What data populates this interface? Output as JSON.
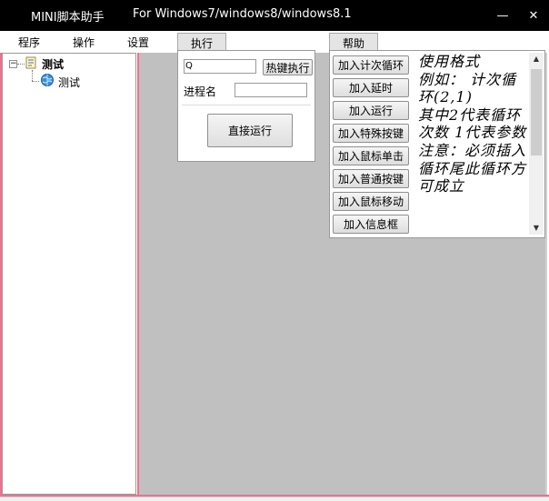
{
  "window": {
    "title": "MINI脚本助手",
    "subtitle": "For Windows7/windows8/windows8.1",
    "minimize_glyph": "—",
    "close_glyph": "✕"
  },
  "menu": {
    "items": [
      "程序",
      "操作",
      "设置",
      "执行",
      "帮助"
    ]
  },
  "tree": {
    "toggle": "−",
    "root_label": "测试",
    "child_label": "测试"
  },
  "execute_panel": {
    "hotkey_value": "Q",
    "hotkey_button": "热键执行",
    "process_label": "进程名",
    "process_value": "",
    "run_button": "直接运行"
  },
  "help_panel": {
    "buttons": [
      "加入计次循环",
      "加入延时",
      "加入运行",
      "加入特殊按键",
      "加入鼠标单击",
      "加入普通按键",
      "加入鼠标移动",
      "加入信息框"
    ],
    "text": "使用格式\n例如： 计次循环(2,1)\n其中2代表循环次数 1代表参数\n注意：必须插入循环尾此循环方可成立"
  },
  "colors": {
    "titlebar": "#000000",
    "accent_border": "#f07090",
    "workspace": "#c0c0c0"
  },
  "icons": {
    "root": "script-icon",
    "child": "globe-icon",
    "toggle": "collapse-icon"
  }
}
